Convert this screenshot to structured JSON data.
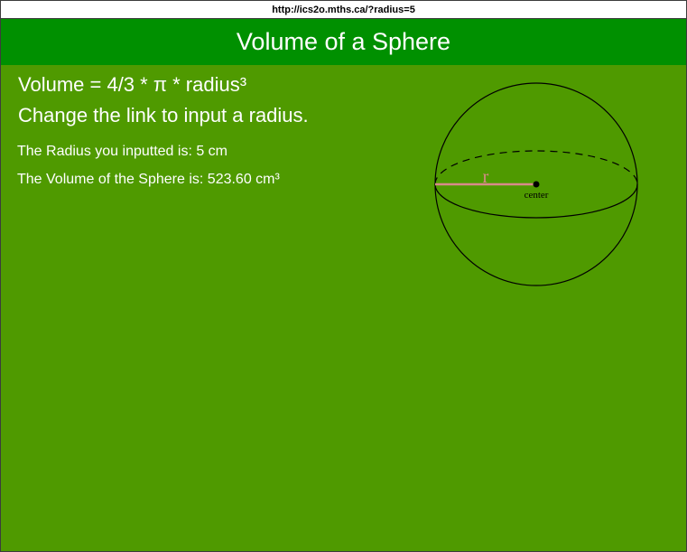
{
  "browser": {
    "url": "http://ics2o.mths.ca/?radius=5"
  },
  "header": {
    "title": "Volume of a Sphere"
  },
  "main": {
    "formula": "Volume = 4/3 * π * radius³",
    "instruction": "Change the link to input a radius.",
    "radius_line": "The Radius you inputted is: 5 cm",
    "volume_line": "The Volume of the Sphere is: 523.60 cm³"
  },
  "diagram": {
    "radius_label": "r",
    "center_label": "center"
  },
  "colors": {
    "page_bg": "#4f9a00",
    "header_bg": "#009000",
    "radius_line": "#d98a8a"
  }
}
